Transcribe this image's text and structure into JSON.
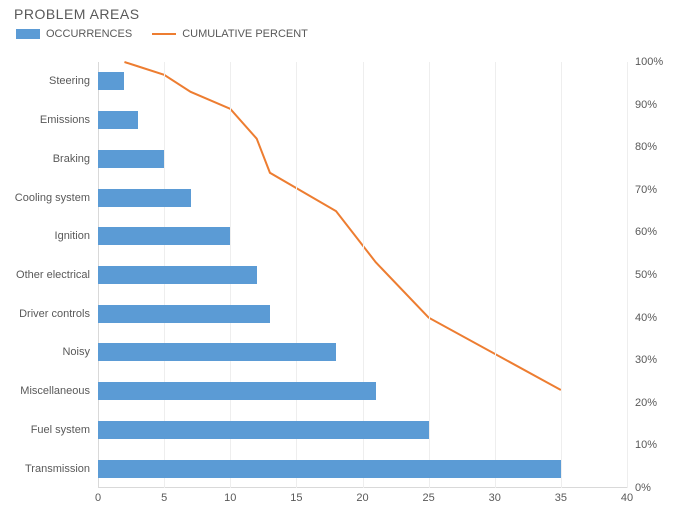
{
  "chart_data": {
    "type": "bar",
    "title": "PROBLEM AREAS",
    "legend": [
      "OCCURRENCES",
      "CUMULATIVE PERCENT"
    ],
    "categories_top_to_bottom": [
      "Steering",
      "Emissions",
      "Braking",
      "Cooling system",
      "Ignition",
      "Other electrical",
      "Driver controls",
      "Noisy",
      "Miscellaneous",
      "Fuel system",
      "Transmission"
    ],
    "series": [
      {
        "name": "OCCURRENCES",
        "axis": "x",
        "values_top_to_bottom": [
          2,
          3,
          5,
          7,
          10,
          12,
          13,
          18,
          21,
          25,
          35
        ]
      },
      {
        "name": "CUMULATIVE PERCENT",
        "axis": "x2_percent",
        "values_top_to_bottom": [
          100,
          99,
          97,
          93,
          89,
          82,
          74,
          65,
          53,
          40,
          23
        ]
      }
    ],
    "x": {
      "label": "",
      "min": 0,
      "max": 40,
      "ticks": [
        0,
        5,
        10,
        15,
        20,
        25,
        30,
        35,
        40
      ]
    },
    "x2_percent": {
      "label": "",
      "min": 0,
      "max": 100,
      "ticks_pct": [
        0,
        10,
        20,
        30,
        40,
        50,
        60,
        70,
        80,
        90,
        100
      ]
    },
    "colors": {
      "bar": "#5b9bd5",
      "line": "#ed7d31"
    }
  }
}
